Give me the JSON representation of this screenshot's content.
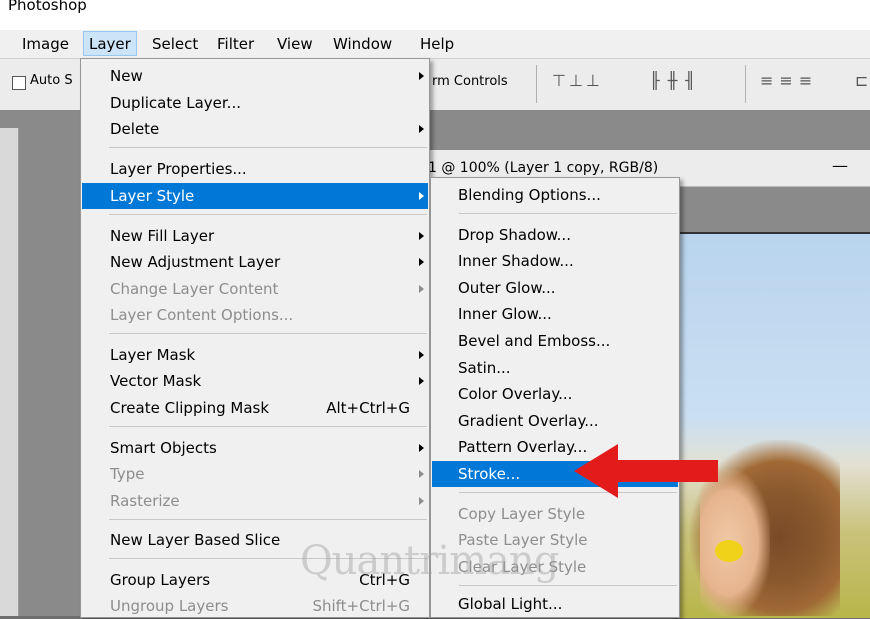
{
  "app_title": "Photoshop",
  "menubar": [
    "Image",
    "Layer",
    "Select",
    "Filter",
    "View",
    "Window",
    "Help"
  ],
  "optionsbar": {
    "auto_select": "Auto S",
    "transform_controls": "rm Controls"
  },
  "document": {
    "tab_title": "1 @ 100% (Layer 1 copy, RGB/8)",
    "minimize": "—"
  },
  "layer_menu": [
    {
      "label": "New",
      "submenu": true
    },
    {
      "label": "Duplicate Layer..."
    },
    {
      "label": "Delete",
      "submenu": true
    },
    {
      "label": "Layer Properties..."
    },
    {
      "label": "Layer Style",
      "submenu": true,
      "highlighted": true
    },
    {
      "label": "New Fill Layer",
      "submenu": true
    },
    {
      "label": "New Adjustment Layer",
      "submenu": true
    },
    {
      "label": "Change Layer Content",
      "submenu": true,
      "disabled": true
    },
    {
      "label": "Layer Content Options...",
      "disabled": true
    },
    {
      "label": "Layer Mask",
      "submenu": true
    },
    {
      "label": "Vector Mask",
      "submenu": true
    },
    {
      "label": "Create Clipping Mask",
      "shortcut": "Alt+Ctrl+G"
    },
    {
      "label": "Smart Objects",
      "submenu": true
    },
    {
      "label": "Type",
      "submenu": true,
      "disabled": true
    },
    {
      "label": "Rasterize",
      "submenu": true,
      "disabled": true
    },
    {
      "label": "New Layer Based Slice"
    },
    {
      "label": "Group Layers",
      "shortcut": "Ctrl+G"
    },
    {
      "label": "Ungroup Layers",
      "shortcut": "Shift+Ctrl+G",
      "disabled": true
    }
  ],
  "layer_style_menu": [
    {
      "label": "Blending Options..."
    },
    {
      "label": "Drop Shadow..."
    },
    {
      "label": "Inner Shadow..."
    },
    {
      "label": "Outer Glow..."
    },
    {
      "label": "Inner Glow..."
    },
    {
      "label": "Bevel and Emboss..."
    },
    {
      "label": "Satin..."
    },
    {
      "label": "Color Overlay..."
    },
    {
      "label": "Gradient Overlay..."
    },
    {
      "label": "Pattern Overlay..."
    },
    {
      "label": "Stroke...",
      "highlighted": true
    },
    {
      "label": "Copy Layer Style",
      "disabled": true
    },
    {
      "label": "Paste Layer Style",
      "disabled": true
    },
    {
      "label": "Clear Layer Style",
      "disabled": true
    },
    {
      "label": "Global Light..."
    }
  ],
  "watermark": "Quantrimang",
  "colors": {
    "highlight": "#0078d7",
    "arrow": "#e31b1b"
  }
}
